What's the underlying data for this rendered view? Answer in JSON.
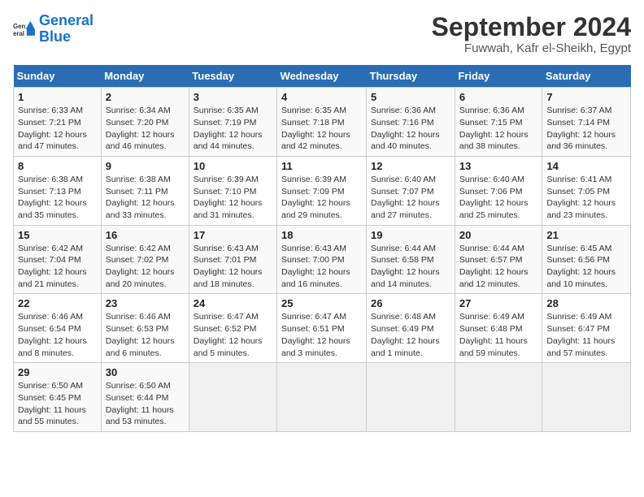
{
  "header": {
    "logo_line1": "General",
    "logo_line2": "Blue",
    "month": "September 2024",
    "location": "Fuwwah, Kafr el-Sheikh, Egypt"
  },
  "weekdays": [
    "Sunday",
    "Monday",
    "Tuesday",
    "Wednesday",
    "Thursday",
    "Friday",
    "Saturday"
  ],
  "weeks": [
    [
      {
        "day": "1",
        "info": "Sunrise: 6:33 AM\nSunset: 7:21 PM\nDaylight: 12 hours and 47 minutes."
      },
      {
        "day": "2",
        "info": "Sunrise: 6:34 AM\nSunset: 7:20 PM\nDaylight: 12 hours and 46 minutes."
      },
      {
        "day": "3",
        "info": "Sunrise: 6:35 AM\nSunset: 7:19 PM\nDaylight: 12 hours and 44 minutes."
      },
      {
        "day": "4",
        "info": "Sunrise: 6:35 AM\nSunset: 7:18 PM\nDaylight: 12 hours and 42 minutes."
      },
      {
        "day": "5",
        "info": "Sunrise: 6:36 AM\nSunset: 7:16 PM\nDaylight: 12 hours and 40 minutes."
      },
      {
        "day": "6",
        "info": "Sunrise: 6:36 AM\nSunset: 7:15 PM\nDaylight: 12 hours and 38 minutes."
      },
      {
        "day": "7",
        "info": "Sunrise: 6:37 AM\nSunset: 7:14 PM\nDaylight: 12 hours and 36 minutes."
      }
    ],
    [
      {
        "day": "8",
        "info": "Sunrise: 6:38 AM\nSunset: 7:13 PM\nDaylight: 12 hours and 35 minutes."
      },
      {
        "day": "9",
        "info": "Sunrise: 6:38 AM\nSunset: 7:11 PM\nDaylight: 12 hours and 33 minutes."
      },
      {
        "day": "10",
        "info": "Sunrise: 6:39 AM\nSunset: 7:10 PM\nDaylight: 12 hours and 31 minutes."
      },
      {
        "day": "11",
        "info": "Sunrise: 6:39 AM\nSunset: 7:09 PM\nDaylight: 12 hours and 29 minutes."
      },
      {
        "day": "12",
        "info": "Sunrise: 6:40 AM\nSunset: 7:07 PM\nDaylight: 12 hours and 27 minutes."
      },
      {
        "day": "13",
        "info": "Sunrise: 6:40 AM\nSunset: 7:06 PM\nDaylight: 12 hours and 25 minutes."
      },
      {
        "day": "14",
        "info": "Sunrise: 6:41 AM\nSunset: 7:05 PM\nDaylight: 12 hours and 23 minutes."
      }
    ],
    [
      {
        "day": "15",
        "info": "Sunrise: 6:42 AM\nSunset: 7:04 PM\nDaylight: 12 hours and 21 minutes."
      },
      {
        "day": "16",
        "info": "Sunrise: 6:42 AM\nSunset: 7:02 PM\nDaylight: 12 hours and 20 minutes."
      },
      {
        "day": "17",
        "info": "Sunrise: 6:43 AM\nSunset: 7:01 PM\nDaylight: 12 hours and 18 minutes."
      },
      {
        "day": "18",
        "info": "Sunrise: 6:43 AM\nSunset: 7:00 PM\nDaylight: 12 hours and 16 minutes."
      },
      {
        "day": "19",
        "info": "Sunrise: 6:44 AM\nSunset: 6:58 PM\nDaylight: 12 hours and 14 minutes."
      },
      {
        "day": "20",
        "info": "Sunrise: 6:44 AM\nSunset: 6:57 PM\nDaylight: 12 hours and 12 minutes."
      },
      {
        "day": "21",
        "info": "Sunrise: 6:45 AM\nSunset: 6:56 PM\nDaylight: 12 hours and 10 minutes."
      }
    ],
    [
      {
        "day": "22",
        "info": "Sunrise: 6:46 AM\nSunset: 6:54 PM\nDaylight: 12 hours and 8 minutes."
      },
      {
        "day": "23",
        "info": "Sunrise: 6:46 AM\nSunset: 6:53 PM\nDaylight: 12 hours and 6 minutes."
      },
      {
        "day": "24",
        "info": "Sunrise: 6:47 AM\nSunset: 6:52 PM\nDaylight: 12 hours and 5 minutes."
      },
      {
        "day": "25",
        "info": "Sunrise: 6:47 AM\nSunset: 6:51 PM\nDaylight: 12 hours and 3 minutes."
      },
      {
        "day": "26",
        "info": "Sunrise: 6:48 AM\nSunset: 6:49 PM\nDaylight: 12 hours and 1 minute."
      },
      {
        "day": "27",
        "info": "Sunrise: 6:49 AM\nSunset: 6:48 PM\nDaylight: 11 hours and 59 minutes."
      },
      {
        "day": "28",
        "info": "Sunrise: 6:49 AM\nSunset: 6:47 PM\nDaylight: 11 hours and 57 minutes."
      }
    ],
    [
      {
        "day": "29",
        "info": "Sunrise: 6:50 AM\nSunset: 6:45 PM\nDaylight: 11 hours and 55 minutes."
      },
      {
        "day": "30",
        "info": "Sunrise: 6:50 AM\nSunset: 6:44 PM\nDaylight: 11 hours and 53 minutes."
      },
      {
        "day": "",
        "info": ""
      },
      {
        "day": "",
        "info": ""
      },
      {
        "day": "",
        "info": ""
      },
      {
        "day": "",
        "info": ""
      },
      {
        "day": "",
        "info": ""
      }
    ]
  ]
}
